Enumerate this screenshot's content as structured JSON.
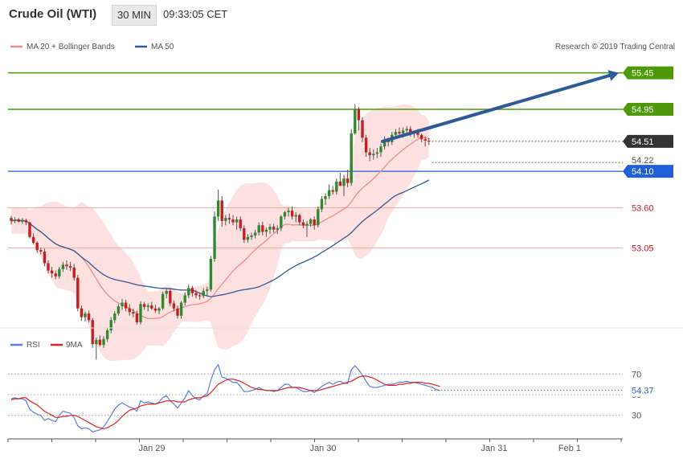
{
  "header": {
    "title": "Crude Oil (WTI)",
    "timeframe": "30 MIN",
    "time": "09:33:05 CET"
  },
  "legend": {
    "ma20_label": "MA 20 + Bollinger Bands",
    "ma50_label": "MA 50",
    "credit": "Research © 2019 Trading Central"
  },
  "rsi_legend": {
    "rsi_label": "RSI",
    "ma_label": "9MA"
  },
  "colors": {
    "ma20": "#f08a8a",
    "ma50": "#2f5a9a",
    "band_fill": "#fde0e0",
    "bull": "#2f8a2f",
    "bear": "#c42020",
    "target": "#4c9a0a",
    "support": "#1f5fd8",
    "pivot": "#f2a6a6",
    "last_price": "#333333",
    "arrow": "#2f5a9a",
    "rsi": "#5a7fe0",
    "rsi_ma": "#e02020"
  },
  "chart_data": [
    {
      "type": "candlestick",
      "title": "Crude Oil (WTI)",
      "timeframe": "30 MIN",
      "x_labels": [
        "Jan 29",
        "Jan 30",
        "Jan 31",
        "Feb 1"
      ],
      "ylim": [
        52.25,
        55.6
      ],
      "price_levels": [
        {
          "name": "resistance-2",
          "value": 55.45,
          "label": "55.45",
          "style": "target"
        },
        {
          "name": "resistance-1",
          "value": 54.95,
          "label": "54.95",
          "style": "target"
        },
        {
          "name": "last-price",
          "value": 54.51,
          "label": "54.51",
          "style": "last"
        },
        {
          "name": "ma50-value",
          "value": 54.22,
          "label": "54.22",
          "style": "dotted"
        },
        {
          "name": "pivot",
          "value": 54.1,
          "label": "54.10",
          "style": "support"
        },
        {
          "name": "support-1",
          "value": 53.6,
          "label": "53.60",
          "style": "pivot"
        },
        {
          "name": "support-2",
          "value": 53.05,
          "label": "53.05",
          "style": "pivot"
        }
      ],
      "forecast_arrow": {
        "from_index": 100,
        "from_value": 54.51,
        "to_index": 109,
        "to_value": 55.45
      },
      "candles": [
        [
          53.46,
          53.49,
          53.37,
          53.42
        ],
        [
          53.42,
          53.47,
          53.39,
          53.44
        ],
        [
          53.44,
          53.46,
          53.4,
          53.41
        ],
        [
          53.41,
          53.46,
          53.38,
          53.43
        ],
        [
          53.43,
          53.45,
          53.36,
          53.4
        ],
        [
          53.4,
          53.41,
          53.18,
          53.2
        ],
        [
          53.2,
          53.25,
          53.1,
          53.12
        ],
        [
          53.12,
          53.14,
          52.98,
          53.02
        ],
        [
          53.02,
          53.05,
          52.96,
          53.0
        ],
        [
          53.0,
          53.04,
          52.8,
          52.84
        ],
        [
          52.84,
          52.88,
          52.7,
          52.74
        ],
        [
          52.74,
          52.79,
          52.64,
          52.7
        ],
        [
          52.7,
          52.74,
          52.62,
          52.66
        ],
        [
          52.66,
          52.79,
          52.63,
          52.76
        ],
        [
          52.76,
          52.86,
          52.72,
          52.82
        ],
        [
          52.82,
          52.88,
          52.75,
          52.8
        ],
        [
          52.8,
          52.86,
          52.73,
          52.78
        ],
        [
          52.78,
          52.83,
          52.6,
          52.64
        ],
        [
          52.64,
          52.68,
          52.18,
          52.22
        ],
        [
          52.22,
          52.26,
          52.05,
          52.1
        ],
        [
          52.1,
          52.18,
          52.04,
          52.15
        ],
        [
          52.15,
          52.19,
          52.03,
          52.06
        ],
        [
          52.06,
          52.09,
          51.68,
          51.73
        ],
        [
          51.73,
          51.82,
          51.52,
          51.79
        ],
        [
          51.79,
          51.85,
          51.7,
          51.72
        ],
        [
          51.72,
          51.84,
          51.68,
          51.8
        ],
        [
          51.8,
          51.96,
          51.76,
          51.92
        ],
        [
          51.92,
          52.1,
          51.88,
          52.06
        ],
        [
          52.06,
          52.18,
          52.02,
          52.15
        ],
        [
          52.15,
          52.28,
          52.12,
          52.25
        ],
        [
          52.25,
          52.35,
          52.2,
          52.3
        ],
        [
          52.3,
          52.34,
          52.18,
          52.22
        ],
        [
          52.22,
          52.28,
          52.12,
          52.17
        ],
        [
          52.17,
          52.22,
          52.1,
          52.15
        ],
        [
          52.15,
          52.19,
          52.0,
          52.03
        ],
        [
          52.03,
          52.32,
          52.0,
          52.28
        ],
        [
          52.28,
          52.31,
          52.2,
          52.24
        ],
        [
          52.24,
          52.29,
          52.18,
          52.26
        ],
        [
          52.26,
          52.31,
          52.2,
          52.22
        ],
        [
          52.22,
          52.27,
          52.16,
          52.19
        ],
        [
          52.19,
          52.24,
          52.14,
          52.22
        ],
        [
          52.22,
          52.45,
          52.2,
          52.42
        ],
        [
          52.42,
          52.49,
          52.36,
          52.46
        ],
        [
          52.46,
          52.5,
          52.25,
          52.29
        ],
        [
          52.29,
          52.33,
          52.18,
          52.22
        ],
        [
          52.22,
          52.26,
          52.08,
          52.12
        ],
        [
          52.12,
          52.32,
          52.08,
          52.3
        ],
        [
          52.3,
          52.44,
          52.26,
          52.4
        ],
        [
          52.4,
          52.55,
          52.36,
          52.5
        ],
        [
          52.5,
          52.53,
          52.38,
          52.43
        ],
        [
          52.43,
          52.47,
          52.36,
          52.4
        ],
        [
          52.4,
          52.44,
          52.34,
          52.39
        ],
        [
          52.39,
          52.5,
          52.36,
          52.46
        ],
        [
          52.46,
          52.52,
          52.4,
          52.48
        ],
        [
          52.48,
          52.94,
          52.45,
          52.9
        ],
        [
          52.9,
          53.55,
          52.86,
          53.48
        ],
        [
          53.48,
          53.85,
          53.42,
          53.7
        ],
        [
          53.7,
          53.76,
          53.34,
          53.42
        ],
        [
          53.42,
          53.5,
          53.36,
          53.46
        ],
        [
          53.46,
          53.52,
          53.38,
          53.44
        ],
        [
          53.44,
          53.5,
          53.36,
          53.4
        ],
        [
          53.4,
          53.48,
          53.3,
          53.44
        ],
        [
          53.44,
          53.48,
          53.28,
          53.32
        ],
        [
          53.32,
          53.36,
          53.12,
          53.16
        ],
        [
          53.16,
          53.24,
          53.12,
          53.2
        ],
        [
          53.2,
          53.26,
          53.16,
          53.22
        ],
        [
          53.22,
          53.3,
          53.18,
          53.26
        ],
        [
          53.26,
          53.4,
          53.22,
          53.36
        ],
        [
          53.36,
          53.41,
          53.22,
          53.27
        ],
        [
          53.27,
          53.33,
          53.2,
          53.3
        ],
        [
          53.3,
          53.38,
          53.24,
          53.34
        ],
        [
          53.34,
          53.38,
          53.26,
          53.3
        ],
        [
          53.3,
          53.36,
          53.24,
          53.32
        ],
        [
          53.32,
          53.5,
          53.28,
          53.48
        ],
        [
          53.48,
          53.56,
          53.44,
          53.54
        ],
        [
          53.54,
          53.6,
          53.48,
          53.56
        ],
        [
          53.56,
          53.62,
          53.44,
          53.48
        ],
        [
          53.48,
          53.54,
          53.4,
          53.5
        ],
        [
          53.5,
          53.52,
          53.36,
          53.4
        ],
        [
          53.4,
          53.44,
          53.32,
          53.36
        ],
        [
          53.36,
          53.42,
          53.2,
          53.38
        ],
        [
          53.38,
          53.46,
          53.34,
          53.44
        ],
        [
          53.44,
          53.48,
          53.3,
          53.36
        ],
        [
          53.36,
          53.62,
          53.33,
          53.58
        ],
        [
          53.58,
          53.76,
          53.54,
          53.72
        ],
        [
          53.72,
          53.8,
          53.64,
          53.76
        ],
        [
          53.76,
          53.92,
          53.72,
          53.84
        ],
        [
          53.84,
          53.9,
          53.78,
          53.82
        ],
        [
          53.82,
          54.0,
          53.78,
          53.96
        ],
        [
          53.96,
          54.08,
          53.9,
          53.9
        ],
        [
          53.9,
          54.05,
          53.76,
          54.0
        ],
        [
          54.0,
          54.12,
          53.88,
          53.94
        ],
        [
          53.94,
          54.68,
          53.9,
          54.62
        ],
        [
          54.62,
          55.02,
          54.6,
          54.95
        ],
        [
          54.95,
          54.98,
          54.66,
          54.8
        ],
        [
          54.8,
          54.84,
          54.5,
          54.56
        ],
        [
          54.56,
          54.6,
          54.3,
          54.36
        ],
        [
          54.36,
          54.42,
          54.24,
          54.32
        ],
        [
          54.32,
          54.4,
          54.26,
          54.34
        ],
        [
          54.34,
          54.42,
          54.28,
          54.36
        ],
        [
          54.36,
          54.48,
          54.3,
          54.44
        ],
        [
          54.44,
          54.58,
          54.4,
          54.52
        ],
        [
          54.52,
          54.56,
          54.44,
          54.5
        ],
        [
          54.5,
          54.64,
          54.46,
          54.6
        ],
        [
          54.6,
          54.68,
          54.54,
          54.64
        ],
        [
          54.64,
          54.7,
          54.58,
          54.62
        ],
        [
          54.62,
          54.7,
          54.56,
          54.66
        ],
        [
          54.66,
          54.72,
          54.6,
          54.68
        ],
        [
          54.68,
          54.72,
          54.58,
          54.62
        ],
        [
          54.62,
          54.66,
          54.56,
          54.64
        ],
        [
          54.64,
          54.68,
          54.56,
          54.6
        ],
        [
          54.6,
          54.62,
          54.5,
          54.54
        ],
        [
          54.54,
          54.58,
          54.44,
          54.52
        ],
        [
          54.52,
          54.56,
          54.46,
          54.51
        ]
      ]
    },
    {
      "type": "line",
      "title": "RSI",
      "ylim": [
        15,
        85
      ],
      "y_ticks": [
        30,
        50,
        70
      ],
      "x_labels": [
        "Jan 29",
        "Jan 30",
        "Jan 31",
        "Feb 1"
      ],
      "last_value": {
        "value": 54.37,
        "label": "54.37"
      },
      "series": [
        {
          "name": "RSI",
          "color": "#5a7fe0",
          "values": [
            46,
            47,
            46,
            46,
            44,
            36,
            33,
            31,
            30,
            25,
            27,
            25,
            24,
            30,
            34,
            33,
            32,
            28,
            20,
            17,
            18,
            17,
            14,
            15,
            16,
            19,
            24,
            30,
            36,
            40,
            42,
            40,
            38,
            37,
            34,
            44,
            42,
            43,
            42,
            41,
            43,
            47,
            49,
            44,
            41,
            37,
            42,
            47,
            54,
            49,
            46,
            45,
            49,
            51,
            64,
            74,
            79,
            67,
            66,
            64,
            62,
            62,
            58,
            53,
            53,
            54,
            55,
            57,
            55,
            54,
            54,
            53,
            54,
            57,
            60,
            60,
            57,
            57,
            55,
            53,
            53,
            54,
            52,
            55,
            58,
            60,
            62,
            60,
            62,
            63,
            61,
            61,
            74,
            78,
            74,
            69,
            63,
            58,
            57,
            57,
            58,
            59,
            60,
            60,
            61,
            62,
            62,
            63,
            62,
            62,
            61,
            60,
            59,
            58,
            57,
            55,
            54
          ]
        },
        {
          "name": "9MA",
          "color": "#e02020",
          "values": [
            45,
            46,
            46,
            47,
            47,
            44,
            42,
            40,
            37,
            34,
            32,
            30,
            28,
            28,
            29,
            29,
            30,
            30,
            29,
            27,
            25,
            23,
            21,
            19,
            18,
            17,
            18,
            20,
            22,
            25,
            29,
            32,
            35,
            36,
            37,
            39,
            40,
            41,
            41,
            41,
            42,
            43,
            44,
            44,
            44,
            43,
            43,
            43,
            45,
            46,
            47,
            47,
            48,
            49,
            52,
            56,
            60,
            62,
            64,
            65,
            65,
            64,
            63,
            61,
            59,
            57,
            56,
            55,
            55,
            54,
            54,
            54,
            54,
            55,
            56,
            57,
            57,
            57,
            57,
            56,
            55,
            54,
            54,
            54,
            55,
            56,
            57,
            58,
            59,
            60,
            61,
            62,
            63,
            65,
            67,
            68,
            68,
            67,
            66,
            64,
            62,
            60,
            59,
            59,
            59,
            60,
            60,
            61,
            61,
            62,
            62,
            62,
            61,
            61,
            60,
            59,
            58
          ]
        }
      ]
    }
  ]
}
